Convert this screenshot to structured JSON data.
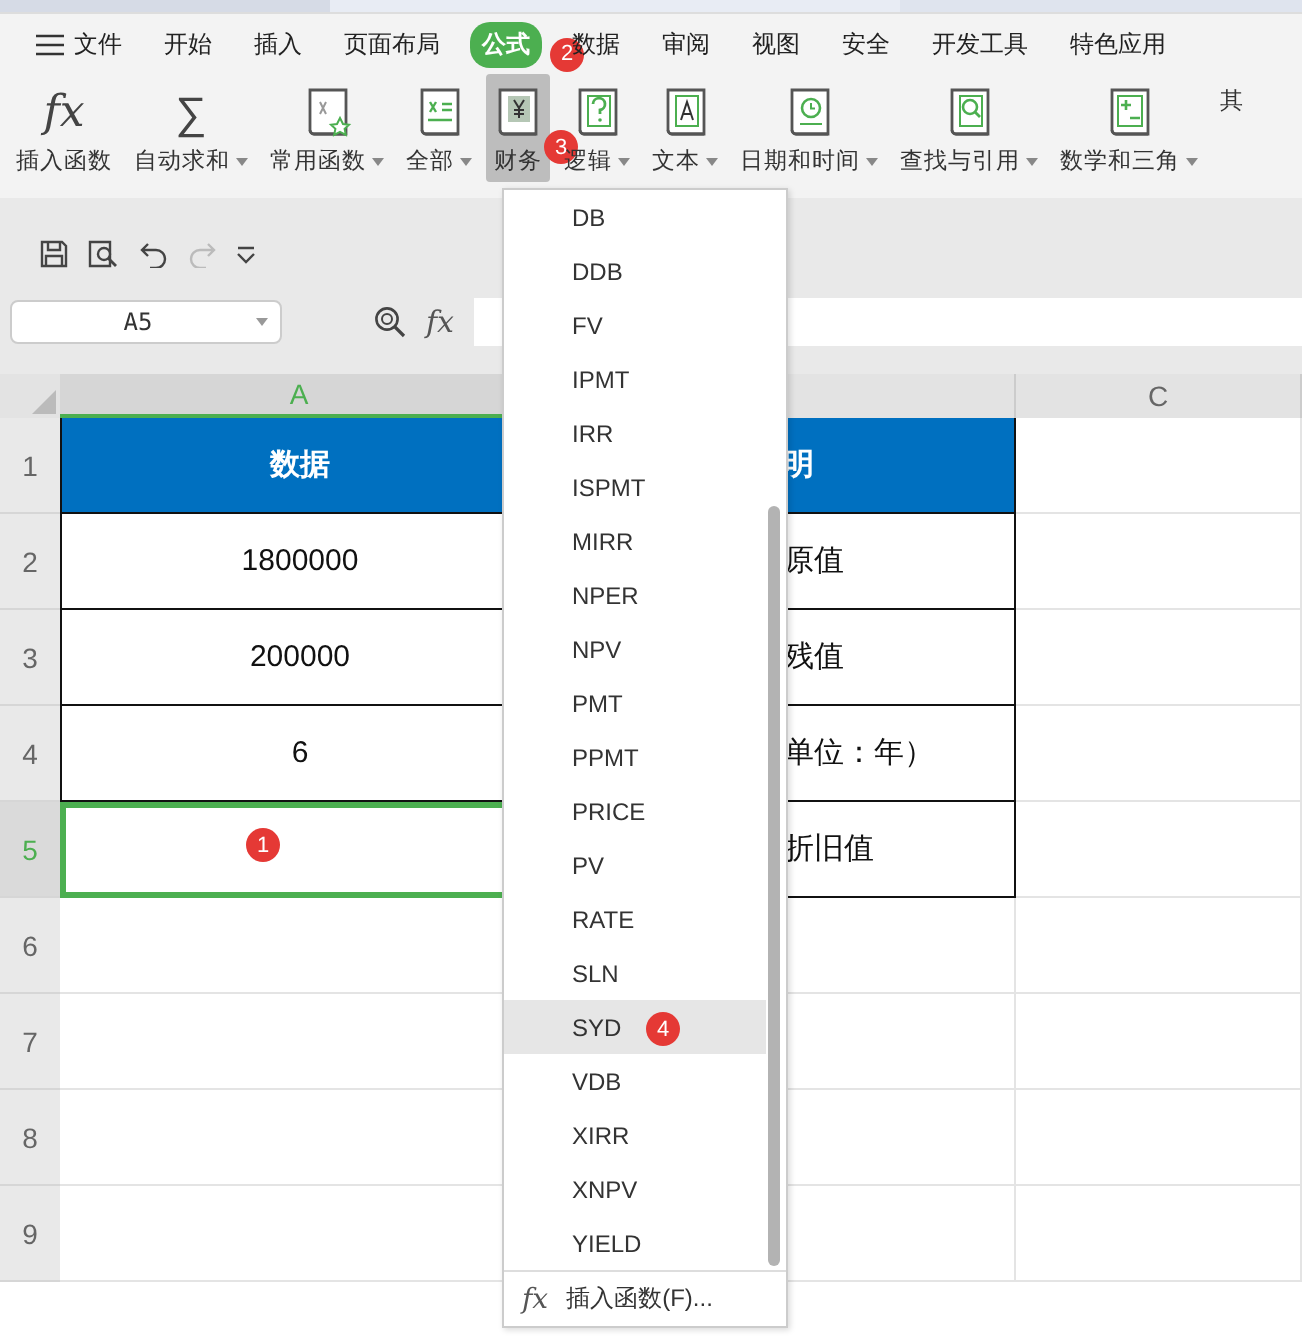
{
  "menu_tabs": [
    {
      "label": "文件",
      "kind": "file",
      "selected": false
    },
    {
      "label": "开始",
      "selected": false
    },
    {
      "label": "插入",
      "selected": false
    },
    {
      "label": "页面布局",
      "selected": false
    },
    {
      "label": "公式",
      "selected": true,
      "badge": "2"
    },
    {
      "label": "数据",
      "selected": false
    },
    {
      "label": "审阅",
      "selected": false
    },
    {
      "label": "视图",
      "selected": false
    },
    {
      "label": "安全",
      "selected": false
    },
    {
      "label": "开发工具",
      "selected": false
    },
    {
      "label": "特色应用",
      "selected": false
    }
  ],
  "ribbon": [
    {
      "label": "插入函数",
      "kind": "fx",
      "glyph": "fx",
      "caret": false,
      "selected": false
    },
    {
      "label": "自动求和",
      "kind": "sigma",
      "glyph": "∑",
      "caret": true,
      "selected": false
    },
    {
      "label": "常用函数",
      "kind": "star",
      "caret": true,
      "selected": false
    },
    {
      "label": "全部",
      "kind": "fxbox",
      "caret": true,
      "selected": false
    },
    {
      "label": "财务",
      "kind": "yen",
      "caret": false,
      "selected": true,
      "badge": "3"
    },
    {
      "label": "逻辑",
      "kind": "question",
      "caret": true,
      "selected": false
    },
    {
      "label": "文本",
      "kind": "letter",
      "caret": true,
      "selected": false
    },
    {
      "label": "日期和时间",
      "kind": "clock",
      "caret": true,
      "selected": false
    },
    {
      "label": "查找与引用",
      "kind": "search",
      "caret": true,
      "selected": false
    },
    {
      "label": "数学和三角",
      "kind": "plusminus",
      "caret": true,
      "selected": false
    },
    {
      "label": "其",
      "kind": "none",
      "caret": false,
      "selected": false
    }
  ],
  "name_box": {
    "value": "A5"
  },
  "formula_bar": {
    "fx": "fx"
  },
  "columns": [
    {
      "label": "A",
      "selected": true
    },
    {
      "label": "C",
      "selected": false
    }
  ],
  "rows": [
    {
      "number": "1",
      "cells": [
        "数据",
        "明"
      ],
      "kind": "header",
      "selected": false
    },
    {
      "number": "2",
      "cells": [
        "1800000",
        "原值"
      ],
      "kind": "data",
      "selected": false
    },
    {
      "number": "3",
      "cells": [
        "200000",
        "残值"
      ],
      "kind": "data",
      "selected": false
    },
    {
      "number": "4",
      "cells": [
        "6",
        "单位：年）"
      ],
      "kind": "data",
      "selected": false
    },
    {
      "number": "5",
      "cells": [
        "",
        "折旧值"
      ],
      "kind": "data",
      "selected": true,
      "badge": "1"
    },
    {
      "number": "6",
      "kind": "empty",
      "selected": false
    },
    {
      "number": "7",
      "kind": "empty",
      "selected": false
    },
    {
      "number": "8",
      "kind": "empty",
      "selected": false
    },
    {
      "number": "9",
      "kind": "empty",
      "selected": false
    }
  ],
  "dropdown": {
    "items": [
      {
        "label": "DB",
        "selected": false
      },
      {
        "label": "DDB",
        "selected": false
      },
      {
        "label": "FV",
        "selected": false
      },
      {
        "label": "IPMT",
        "selected": false
      },
      {
        "label": "IRR",
        "selected": false
      },
      {
        "label": "ISPMT",
        "selected": false
      },
      {
        "label": "MIRR",
        "selected": false
      },
      {
        "label": "NPER",
        "selected": false
      },
      {
        "label": "NPV",
        "selected": false
      },
      {
        "label": "PMT",
        "selected": false
      },
      {
        "label": "PPMT",
        "selected": false
      },
      {
        "label": "PRICE",
        "selected": false
      },
      {
        "label": "PV",
        "selected": false
      },
      {
        "label": "RATE",
        "selected": false
      },
      {
        "label": "SLN",
        "selected": false
      },
      {
        "label": "SYD",
        "selected": true,
        "badge": "4"
      },
      {
        "label": "VDB",
        "selected": false
      },
      {
        "label": "XIRR",
        "selected": false
      },
      {
        "label": "XNPV",
        "selected": false
      },
      {
        "label": "YIELD",
        "selected": false
      }
    ],
    "footer": {
      "glyph": "fx",
      "label": "插入函数(F)..."
    }
  }
}
